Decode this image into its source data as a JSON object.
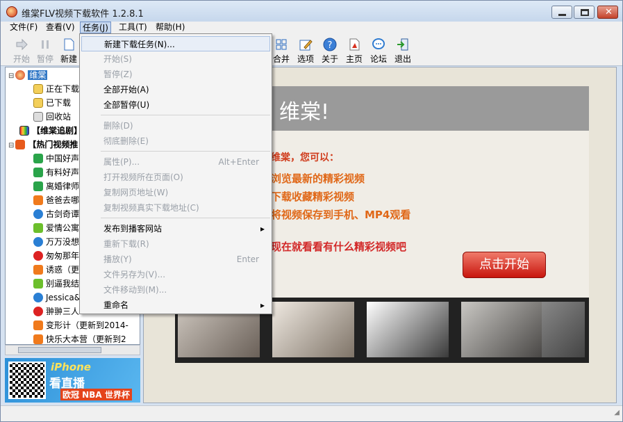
{
  "window": {
    "title": "维棠FLV视频下载软件 1.2.8.1"
  },
  "menubar": [
    "文件(F)",
    "查看(V)",
    "任务(J)",
    "工具(T)",
    "帮助(H)"
  ],
  "toolbar": {
    "start": "开始",
    "pause": "暂停",
    "new": "新建",
    "merge": "合并",
    "options": "选项",
    "about": "关于",
    "home": "主页",
    "forum": "论坛",
    "exit": "退出"
  },
  "tree": [
    {
      "label": "维棠",
      "level": 0
    },
    {
      "label": "正在下载",
      "level": 1
    },
    {
      "label": "已下载",
      "level": 1
    },
    {
      "label": "回收站",
      "level": 1
    },
    {
      "label": "【维棠追剧】",
      "level": 0
    },
    {
      "label": "【热门视频推",
      "level": 0
    },
    {
      "label": "中国好声",
      "level": 1
    },
    {
      "label": "有料好声",
      "level": 1
    },
    {
      "label": "离婚律师",
      "level": 1
    },
    {
      "label": "爸爸去哪",
      "level": 1
    },
    {
      "label": "古剑奇谭",
      "level": 1
    },
    {
      "label": "爱情公寓",
      "level": 1
    },
    {
      "label": "万万没想",
      "level": 1
    },
    {
      "label": "匆匆那年",
      "level": 1
    },
    {
      "label": "诱惑（更",
      "level": 1
    },
    {
      "label": "别逼我结",
      "level": 1
    },
    {
      "label": "Jessica&",
      "level": 1
    },
    {
      "label": "翀翀三人",
      "level": 1
    },
    {
      "label": "变形计（更新到2014-",
      "level": 1
    },
    {
      "label": "快乐大本营（更新到2",
      "level": 1
    }
  ],
  "ad": {
    "line1": "iPhone",
    "line2": "看直播",
    "line3": "欧冠 NBA 世界杯"
  },
  "content": {
    "banner": "维棠!",
    "intro": "维棠，您可以：",
    "bullets": [
      "浏览最新的精彩视频",
      "下载收藏精彩视频",
      "将视频保存到手机、MP4观看"
    ],
    "cta": "现在就看看有什么精彩视频吧",
    "start_button": "点击开始"
  },
  "dropdown": {
    "items": [
      {
        "label": "新建下载任务(N)...",
        "enabled": true,
        "accel": "",
        "sub": false
      },
      {
        "label": "开始(S)",
        "enabled": false,
        "accel": "",
        "sub": false
      },
      {
        "label": "暂停(Z)",
        "enabled": false,
        "accel": "",
        "sub": false
      },
      {
        "label": "全部开始(A)",
        "enabled": true,
        "accel": "",
        "sub": false
      },
      {
        "label": "全部暂停(U)",
        "enabled": true,
        "accel": "",
        "sub": false
      },
      {
        "label": "删除(D)",
        "enabled": false,
        "accel": "",
        "sub": false
      },
      {
        "label": "彻底删除(E)",
        "enabled": false,
        "accel": "",
        "sub": false
      },
      {
        "label": "属性(P)...",
        "enabled": false,
        "accel": "Alt+Enter",
        "sub": false
      },
      {
        "label": "打开视频所在页面(O)",
        "enabled": false,
        "accel": "",
        "sub": false
      },
      {
        "label": "复制网页地址(W)",
        "enabled": false,
        "accel": "",
        "sub": false
      },
      {
        "label": "复制视频真实下载地址(C)",
        "enabled": false,
        "accel": "",
        "sub": false
      },
      {
        "label": "发布到播客网站",
        "enabled": true,
        "accel": "",
        "sub": true
      },
      {
        "label": "重新下载(R)",
        "enabled": false,
        "accel": "",
        "sub": false
      },
      {
        "label": "播放(Y)",
        "enabled": false,
        "accel": "Enter",
        "sub": false
      },
      {
        "label": "文件另存为(V)...",
        "enabled": false,
        "accel": "",
        "sub": false
      },
      {
        "label": "文件移动到(M)...",
        "enabled": false,
        "accel": "",
        "sub": false
      },
      {
        "label": "重命名",
        "enabled": true,
        "accel": "",
        "sub": true
      }
    ]
  }
}
